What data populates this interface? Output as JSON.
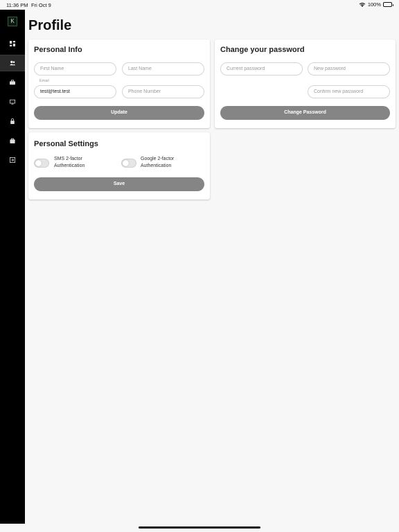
{
  "status_bar": {
    "time": "11:36 PM",
    "date": "Fri Oct 9",
    "battery": "100%"
  },
  "sidebar": {
    "logo_letter": "K",
    "items": [
      {
        "icon": "dashboard-icon"
      },
      {
        "icon": "users-icon",
        "active": true
      },
      {
        "icon": "briefcase-icon"
      },
      {
        "icon": "monitor-icon"
      },
      {
        "icon": "lock-icon"
      },
      {
        "icon": "bag-icon"
      },
      {
        "icon": "logout-icon"
      }
    ]
  },
  "page": {
    "title": "Profile"
  },
  "personal_info": {
    "title": "Personal Info",
    "first_name_placeholder": "First Name",
    "last_name_placeholder": "Last Name",
    "email_label": "Email",
    "email_value": "test@test.test",
    "phone_placeholder": "Phone Number",
    "update_label": "Update"
  },
  "change_password": {
    "title": "Change your password",
    "current_placeholder": "Current password",
    "new_placeholder": "New password",
    "confirm_placeholder": "Confirm new password",
    "button_label": "Change Password"
  },
  "personal_settings": {
    "title": "Personal Settings",
    "sms_label": "SMS 2-factor Authentication",
    "google_label": "Google 2-factor Authentication",
    "sms_enabled": false,
    "google_enabled": false,
    "save_label": "Save"
  },
  "colors": {
    "button": "#858585",
    "sidebar": "#000000",
    "background": "#f7f7f7"
  }
}
